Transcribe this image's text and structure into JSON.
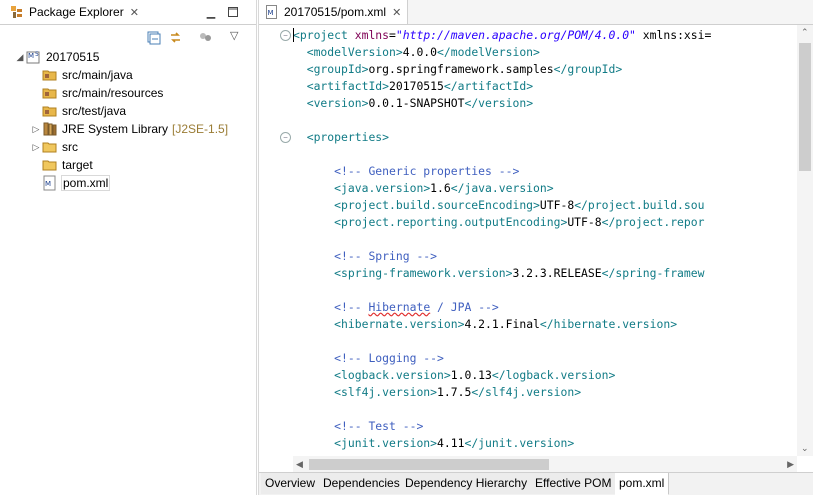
{
  "package_explorer": {
    "title": "Package Explorer",
    "tree": [
      {
        "label": "20170515",
        "icon": "maven-project-icon",
        "expanded": true,
        "level": 0
      },
      {
        "label": "src/main/java",
        "icon": "source-folder-icon",
        "level": 1
      },
      {
        "label": "src/main/resources",
        "icon": "source-folder-icon",
        "level": 1
      },
      {
        "label": "src/test/java",
        "icon": "source-folder-icon",
        "level": 1
      },
      {
        "label": "JRE System Library",
        "suffix": "[J2SE-1.5]",
        "icon": "library-icon",
        "level": 1
      },
      {
        "label": "src",
        "icon": "folder-icon",
        "level": 1
      },
      {
        "label": "target",
        "icon": "folder-icon",
        "level": 1
      },
      {
        "label": "pom.xml",
        "icon": "xml-file-icon",
        "level": 1,
        "selected": true
      }
    ]
  },
  "editor": {
    "tab_title": "20170515/pom.xml",
    "lines": [
      "<project xmlns=\"http://maven.apache.org/POM/4.0.0\" xmlns:xsi=",
      "  <modelVersion>4.0.0</modelVersion>",
      "  <groupId>org.springframework.samples</groupId>",
      "  <artifactId>20170515</artifactId>",
      "  <version>0.0.1-SNAPSHOT</version>",
      "",
      "  <properties>",
      "",
      "      <!-- Generic properties -->",
      "      <java.version>1.6</java.version>",
      "      <project.build.sourceEncoding>UTF-8</project.build.sou",
      "      <project.reporting.outputEncoding>UTF-8</project.repor",
      "",
      "      <!-- Spring -->",
      "      <spring-framework.version>3.2.3.RELEASE</spring-framew",
      "",
      "      <!-- Hibernate / JPA -->",
      "      <hibernate.version>4.2.1.Final</hibernate.version>",
      "",
      "      <!-- Logging -->",
      "      <logback.version>1.0.13</logback.version>",
      "      <slf4j.version>1.7.5</slf4j.version>",
      "",
      "      <!-- Test -->",
      "      <junit.version>4.11</junit.version>"
    ],
    "bottom_tabs": [
      "Overview",
      "Dependencies",
      "Dependency Hierarchy",
      "Effective POM",
      "pom.xml"
    ],
    "active_bottom_tab": "pom.xml"
  },
  "colors": {
    "tag": "#117b86",
    "attribute": "#7f0055",
    "value": "#2a00ff",
    "comment": "#3f5fbf"
  }
}
